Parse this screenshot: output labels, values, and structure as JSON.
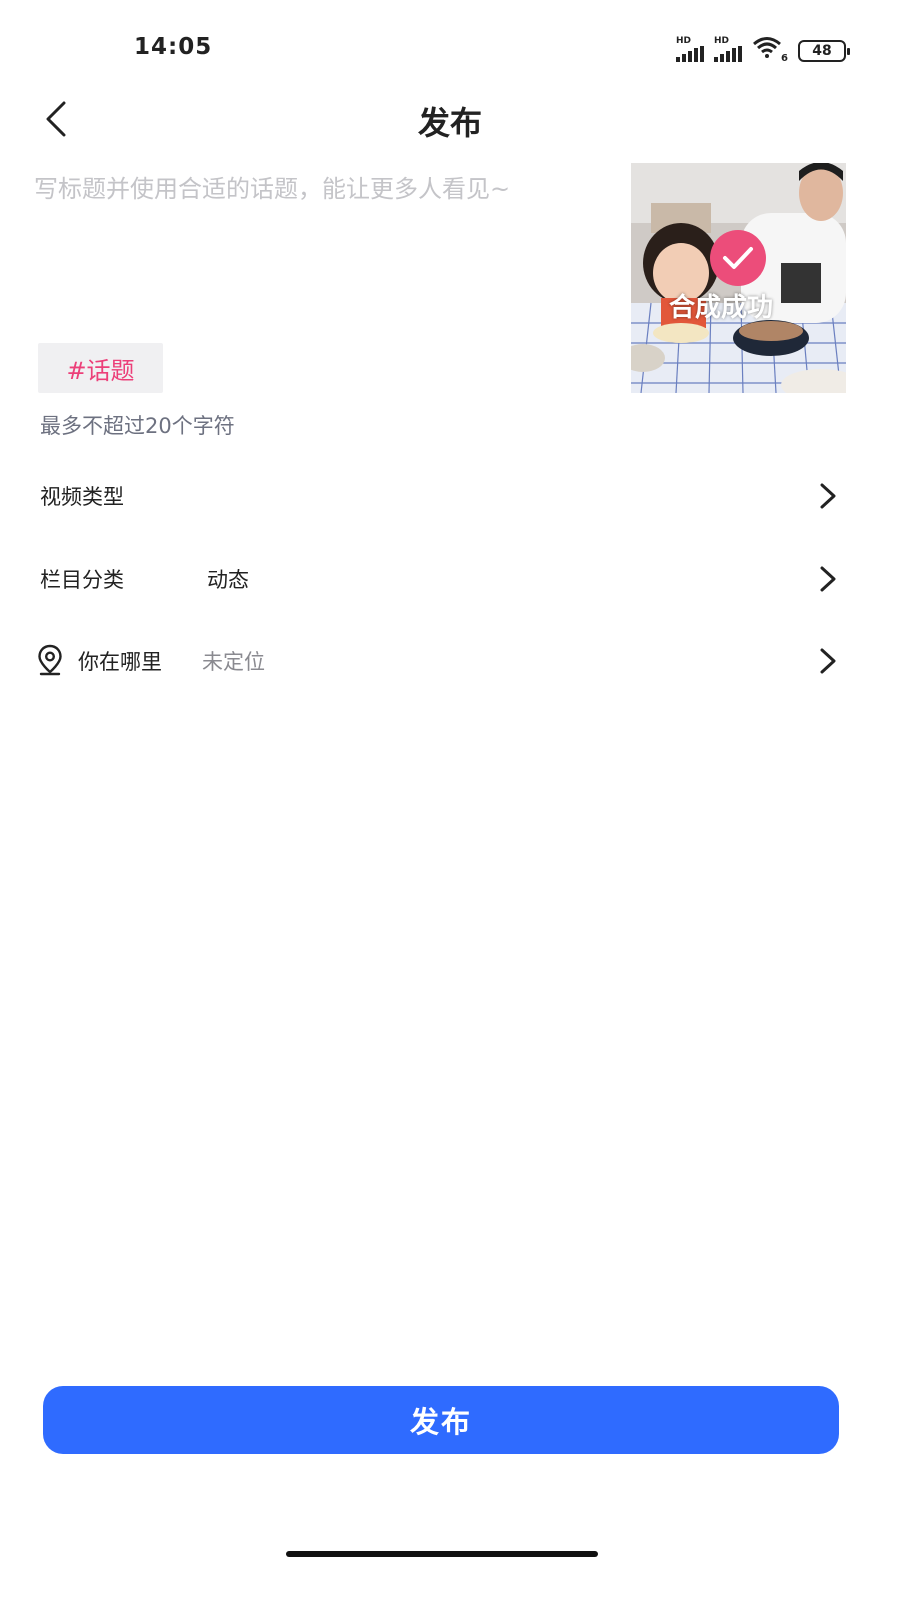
{
  "status_bar": {
    "time": "14:05",
    "signal_1_label": "HD",
    "signal_2_label": "HD",
    "wifi_label": "6",
    "battery": "48",
    "icons": [
      "signal-icon",
      "signal-icon",
      "wifi-icon",
      "battery-icon"
    ]
  },
  "nav": {
    "back_icon": "chevron-left-icon",
    "title": "发布"
  },
  "caption": {
    "value": "",
    "placeholder": "写标题并使用合适的话题，能让更多人看见~"
  },
  "thumbnail": {
    "status_text": "合成成功",
    "status_icon": "check-icon",
    "accent_color": "#ec4d7a"
  },
  "topic": {
    "label": "#话题",
    "color": "#ec3f79"
  },
  "char_hint": "最多不超过20个字符",
  "settings": {
    "video_type": {
      "label": "视频类型",
      "value": ""
    },
    "category": {
      "label": "栏目分类",
      "value": "动态"
    },
    "location": {
      "label": "你在哪里",
      "value": "未定位",
      "icon": "location-pin-icon"
    }
  },
  "publish_button": {
    "label": "发布",
    "color": "#2f6bff"
  }
}
